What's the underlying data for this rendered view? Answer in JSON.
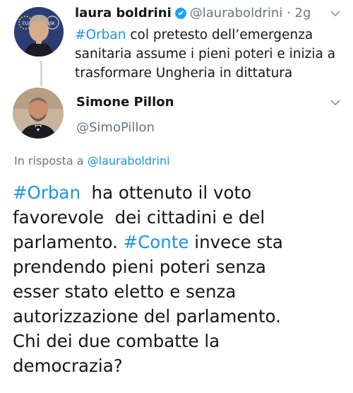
{
  "original_tweet": {
    "name": "laura boldrini",
    "handle": "@lauraboldrini",
    "separator": "·",
    "time": "2g",
    "hashtag": "#Orban",
    "text_line1": " col pretesto dell’emergenza",
    "text_line2": "sanitaria assume i pieni poteri e inizia a",
    "text_line3": "trasformare Ungheria in dittatura",
    "avatar_badge_left": "EU",
    "avatar_badge_right": "SK"
  },
  "reply_tweet": {
    "name": "Simone Pillon",
    "handle": "@SimoPillon",
    "reply_prefix": "In risposta a ",
    "reply_to": "@lauraboldrini",
    "line1_hashtag": "#Orban",
    "line1_rest": "  ha ottenuto il voto",
    "line2": "favorevole  dei cittadini e del",
    "line3_start": "parlamento. ",
    "line3_hashtag": "#Conte",
    "line3_rest": " invece sta",
    "line4": "prendendo pieni poteri senza",
    "line5": "esser stato eletto e senza",
    "line6": "autorizzazione del parlamento.",
    "line7": "Chi dei due combatte la",
    "line8": "democrazia?"
  },
  "icons": {
    "verified": "verified-badge-icon",
    "menu": "chevron-down-icon"
  },
  "colors": {
    "link": "#1b95e0",
    "muted": "#657786",
    "text": "#14171a",
    "verified": "#1da1f2"
  }
}
